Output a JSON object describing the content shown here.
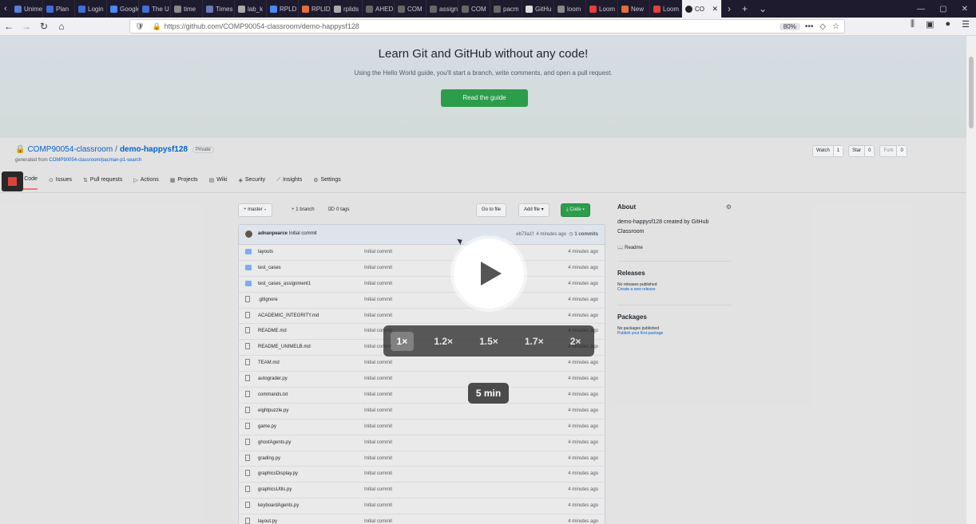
{
  "browser": {
    "tabs": [
      {
        "label": "Unimelb",
        "color": "#5a7fd6"
      },
      {
        "label": "Plan",
        "color": "#3f6fd8"
      },
      {
        "label": "Login",
        "color": "#3f6fd8"
      },
      {
        "label": "Google",
        "color": "#4a8af4"
      },
      {
        "label": "The U",
        "color": "#3f6fd8"
      },
      {
        "label": "time",
        "color": "#888888"
      },
      {
        "label": "Times",
        "color": "#6a7ab8"
      },
      {
        "label": "lab_k",
        "color": "#aaaaaa"
      },
      {
        "label": "RPLD",
        "color": "#4a8af4"
      },
      {
        "label": "RPLID",
        "color": "#e0703a"
      },
      {
        "label": "rplids",
        "color": "#aaaaaa"
      },
      {
        "label": "AHED",
        "color": "#666666"
      },
      {
        "label": "COM",
        "color": "#666666"
      },
      {
        "label": "assign",
        "color": "#666666"
      },
      {
        "label": "COM",
        "color": "#666666"
      },
      {
        "label": "pacm",
        "color": "#666666"
      },
      {
        "label": "GitHu",
        "color": "#dddddd"
      },
      {
        "label": "loom",
        "color": "#888888"
      },
      {
        "label": "Loom",
        "color": "#e0423a"
      },
      {
        "label": "New",
        "color": "#e0703a"
      },
      {
        "label": "Loom",
        "color": "#e0423a"
      }
    ],
    "active_tab": {
      "label": "CO",
      "icon": "github-icon"
    },
    "url": "https://github.com/COMP90054-classroom/demo-happysf128",
    "zoom": "80%"
  },
  "banner": {
    "title": "Learn Git and GitHub without any code!",
    "subtitle": "Using the Hello World guide, you'll start a branch, write comments, and open a pull request.",
    "button": "Read the guide"
  },
  "repo": {
    "owner": "COMP90054-classroom",
    "name": "demo-happysf128",
    "visibility": "Private",
    "generated_prefix": "generated from",
    "generated_from": "COMP90054-classroom/pacman-p1-search",
    "watch_label": "Watch",
    "watch_count": "1",
    "star_label": "Star",
    "star_count": "0",
    "fork_label": "Fork",
    "fork_count": "0"
  },
  "tabs": [
    {
      "label": "Code",
      "icon": "code-icon"
    },
    {
      "label": "Issues",
      "icon": "issue-icon"
    },
    {
      "label": "Pull requests",
      "icon": "pull-request-icon"
    },
    {
      "label": "Actions",
      "icon": "play-icon"
    },
    {
      "label": "Projects",
      "icon": "project-icon"
    },
    {
      "label": "Wiki",
      "icon": "book-icon"
    },
    {
      "label": "Security",
      "icon": "shield-icon"
    },
    {
      "label": "Insights",
      "icon": "graph-icon"
    },
    {
      "label": "Settings",
      "icon": "gear-icon"
    }
  ],
  "branchbar": {
    "branch": "master",
    "branches": "1 branch",
    "tags": "0 tags",
    "go_to_file": "Go to file",
    "add_file": "Add file",
    "code": "Code"
  },
  "commit": {
    "author": "adnanpearce",
    "message": "Initial commit",
    "sha": "eb73a1f",
    "age": "4 minutes ago",
    "count": "1 commits"
  },
  "files": [
    {
      "name": "layouts",
      "type": "dir",
      "msg": "Initial commit",
      "age": "4 minutes ago"
    },
    {
      "name": "test_cases",
      "type": "dir",
      "msg": "Initial commit",
      "age": "4 minutes ago"
    },
    {
      "name": "test_cases_assignment1",
      "type": "dir",
      "msg": "Initial commit",
      "age": "4 minutes ago"
    },
    {
      "name": ".gitignore",
      "type": "file",
      "msg": "Initial commit",
      "age": "4 minutes ago"
    },
    {
      "name": "ACADEMIC_INTEGRITY.md",
      "type": "file",
      "msg": "Initial commit",
      "age": "4 minutes ago"
    },
    {
      "name": "README.md",
      "type": "file",
      "msg": "Initial commit",
      "age": "4 minutes ago"
    },
    {
      "name": "README_UNIMELB.md",
      "type": "file",
      "msg": "Initial commit",
      "age": "4 minutes ago"
    },
    {
      "name": "TEAM.md",
      "type": "file",
      "msg": "Initial commit",
      "age": "4 minutes ago"
    },
    {
      "name": "autograder.py",
      "type": "file",
      "msg": "Initial commit",
      "age": "4 minutes ago"
    },
    {
      "name": "commands.txt",
      "type": "file",
      "msg": "Initial commit",
      "age": "4 minutes ago"
    },
    {
      "name": "eightpuzzle.py",
      "type": "file",
      "msg": "Initial commit",
      "age": "4 minutes ago"
    },
    {
      "name": "game.py",
      "type": "file",
      "msg": "Initial commit",
      "age": "4 minutes ago"
    },
    {
      "name": "ghostAgents.py",
      "type": "file",
      "msg": "Initial commit",
      "age": "4 minutes ago"
    },
    {
      "name": "grading.py",
      "type": "file",
      "msg": "Initial commit",
      "age": "4 minutes ago"
    },
    {
      "name": "graphicsDisplay.py",
      "type": "file",
      "msg": "Initial commit",
      "age": "4 minutes ago"
    },
    {
      "name": "graphicsUtils.py",
      "type": "file",
      "msg": "Initial commit",
      "age": "4 minutes ago"
    },
    {
      "name": "keyboardAgents.py",
      "type": "file",
      "msg": "Initial commit",
      "age": "4 minutes ago"
    },
    {
      "name": "layout.py",
      "type": "file",
      "msg": "Initial commit",
      "age": "4 minutes ago"
    }
  ],
  "about": {
    "heading": "About",
    "description": "demo-happysf128 created by GitHub Classroom",
    "readme": "Readme",
    "releases_heading": "Releases",
    "releases_none": "No releases published",
    "releases_link": "Create a new release",
    "packages_heading": "Packages",
    "packages_none": "No packages published",
    "packages_link": "Publish your first package"
  },
  "player": {
    "speeds": [
      "1×",
      "1.2×",
      "1.5×",
      "1.7×",
      "2×"
    ],
    "selected_speed": "1×",
    "duration": "5 min"
  }
}
